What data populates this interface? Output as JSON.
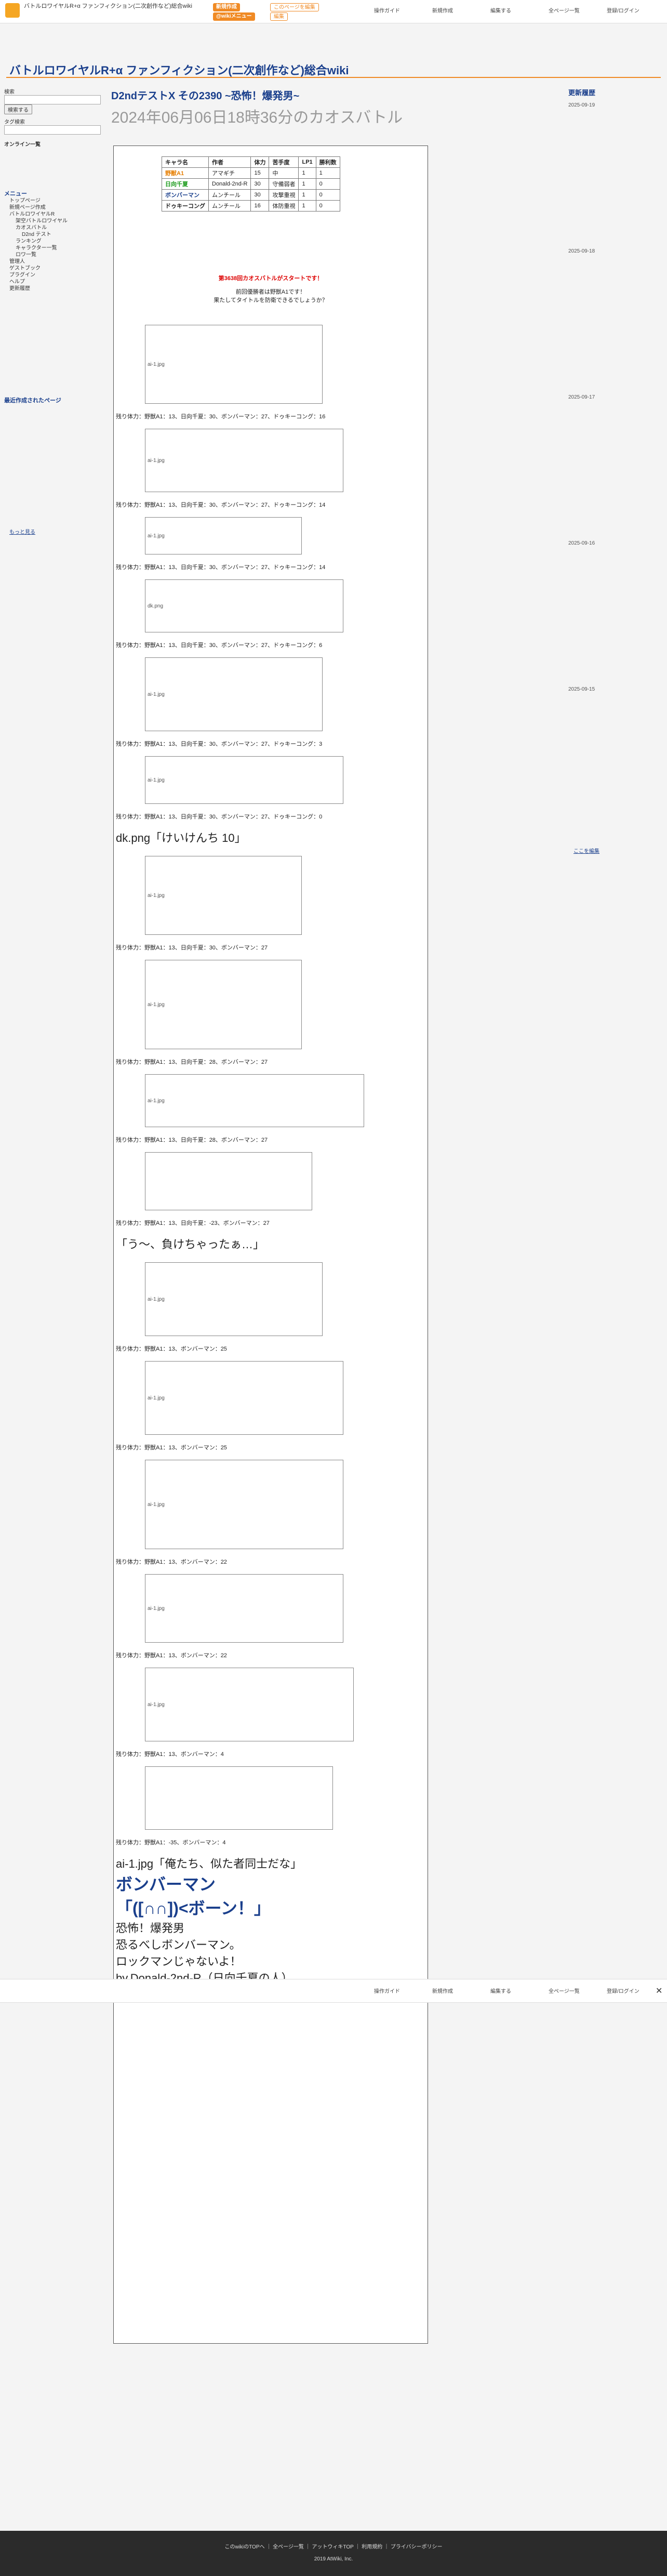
{
  "header": {
    "site_name": "バトルロワイヤルR+α ファンフィクション(二次創作など)総合wiki",
    "buttons": [
      "新規作成",
      "このページを編集",
      "@wikiメニュー",
      "編集"
    ],
    "links": [
      "操作ガイド",
      "新規作成",
      "編集する",
      "全ページ一覧",
      "登録/ログイン"
    ]
  },
  "page": {
    "site_title": "バトルロワイヤルR+α ファンフィクション(二次創作など)総合wiki",
    "story_title": "D2ndテストX その2390 ~恐怖！爆発男~",
    "story_date": "2024年06月06日18時36分のカオスバトル"
  },
  "left": {
    "search_label": "検索",
    "search_button": "検索する",
    "tags_label": "タグ検索",
    "online": "オンライン一覧",
    "menu_title": "メニュー",
    "menu": [
      "トップページ",
      "新規ページ作成",
      "バトルロワイヤルR",
      "架空バトルロワイヤル",
      "カオスバトル",
      "D2nd テスト",
      "ランキング",
      "キャラクター一覧",
      "ロワ一覧",
      "管理人",
      "ゲストブック",
      "プラグイン",
      "ヘルプ",
      "更新履歴"
    ],
    "recent_title": "最近作成されたページ",
    "more": "もっと見る"
  },
  "roster": {
    "headers": [
      "キャラ名",
      "作者",
      "体力",
      "苦手度",
      "LP1",
      "勝利数"
    ],
    "rows": [
      [
        "野獣A1",
        "アマギチ",
        "15",
        "中",
        "1",
        "1"
      ],
      [
        "日向千夏",
        "Donald-2nd-R",
        "30",
        "守備弱者",
        "1",
        "0"
      ],
      [
        "ボンバーマン",
        "ムンチール",
        "30",
        "攻撃重視",
        "1",
        "0"
      ],
      [
        "ドゥキーコング",
        "ムンチール",
        "16",
        "体防重視",
        "1",
        "0"
      ]
    ]
  },
  "story": {
    "intro1": "第3638回カオスバトルがスタートです！",
    "intro2": "前回優勝者は野獣A1です！",
    "intro3": "果たしてタイトルを防衛できるでしょうか？",
    "status_lines": [
      "残り体力：野獣A1：13、日向千夏：30、ボンバーマン：27、ドゥキーコング：16",
      "残り体力：野獣A1：13、日向千夏：30、ボンバーマン：27、ドゥキーコング：14",
      "残り体力：野獣A1：13、日向千夏：30、ボンバーマン：27、ドゥキーコング：14",
      "残り体力：野獣A1：13、日向千夏：30、ボンバーマン：27、ドゥキーコング：6",
      "残り体力：野獣A1：13、日向千夏：30、ボンバーマン：27、ドゥキーコング：3",
      "残り体力：野獣A1：13、日向千夏：30、ボンバーマン：27、ドゥキーコング：0",
      "残り体力：野獣A1：13、日向千夏：30、ボンバーマン：27",
      "残り体力：野獣A1：13、日向千夏：28、ボンバーマン：27",
      "残り体力：野獣A1：13、日向千夏：28、ボンバーマン：27",
      "残り体力：野獣A1：13、日向千夏：-23、ボンバーマン：27",
      "残り体力：野獣A1：13、ボンバーマン：25",
      "残り体力：野獣A1：13、ボンバーマン：25",
      "残り体力：野獣A1：13、ボンバーマン：22",
      "残り体力：野獣A1：13、ボンバーマン：22",
      "残り体力：野獣A1：13、ボンバーマン：4",
      "残り体力：野獣A1：-35、ボンバーマン：4"
    ],
    "dk_line": "dk.png「けいけんち 10」",
    "chinatsu_line": "「う～、負けちゃったぁ…」",
    "final": [
      "ai-1.jpg「俺たち、似た者同士だな」",
      "ボンバーマン",
      "「([∩∩])<ボーン！」",
      "恐怖！爆発男",
      "恐るべしボンバーマン。",
      "ロックマンじゃないよ！",
      "by.Donald-2nd-R（日向千夏の人）"
    ]
  },
  "right": {
    "title": "更新履歴",
    "dates": [
      "2025-09-19",
      "2025-09-18",
      "2025-09-17",
      "2025-09-16",
      "2025-09-15"
    ],
    "more": "ここを編集"
  },
  "overlay": {
    "links": [
      "操作ガイド",
      "新規作成",
      "編集する",
      "全ページ一覧",
      "登録/ログイン"
    ]
  },
  "footer": {
    "links": "このwikiのTOPへ ｜ 全ページ一覧 ｜ アットウィキTOP ｜ 利用規約 ｜ プライバシーポリシー",
    "copyright": "2019 AtWiki, Inc."
  }
}
